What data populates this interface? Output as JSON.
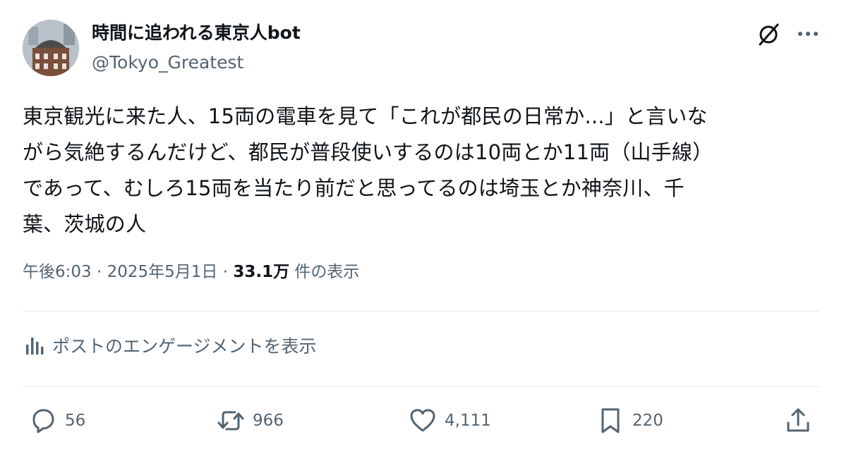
{
  "author": {
    "display_name": "時間に追われる東京人bot",
    "handle": "@Tokyo_Greatest"
  },
  "tweet": {
    "lines": [
      "東京観光に来た人、15両の電車を見て「これが都民の日常か...」と言いな",
      "がら気絶するんだけど、都民が普段使いするのは10両とか11両（山手線）",
      "であって、むしろ15両を当たり前だと思ってるのは埼玉とか神奈川、千",
      "葉、茨城の人"
    ]
  },
  "meta": {
    "time": "午後6:03",
    "separator": " · ",
    "date": "2025年5月1日",
    "separator2": " · ",
    "views": "33.1万",
    "views_suffix": " 件の表示"
  },
  "engagement_link": "ポストのエンゲージメントを表示",
  "actions": {
    "replies": "56",
    "reposts": "966",
    "likes": "4,111",
    "bookmarks": "220"
  },
  "icons": {
    "grok": "grok-icon",
    "more": "more-icon",
    "engagement": "bar-chart-icon",
    "reply": "reply-icon",
    "repost": "repost-icon",
    "like": "heart-icon",
    "bookmark": "bookmark-icon",
    "share": "share-icon"
  },
  "colors": {
    "text": "#0f1419",
    "secondary": "#536471",
    "divider": "#e7eaed"
  }
}
